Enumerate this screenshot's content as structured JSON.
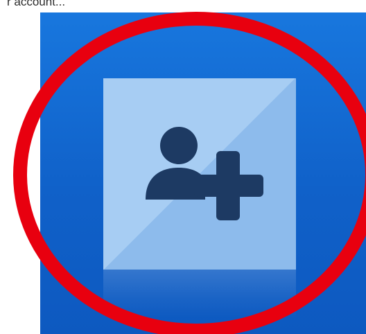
{
  "tile": {
    "caption": "r account...",
    "icon_name": "add-user-icon",
    "colors": {
      "tile_blue": "#1468d2",
      "icon_box": "#a7cdf3",
      "icon_glyph": "#1d3a63",
      "highlight_ring": "#e8000f"
    }
  }
}
